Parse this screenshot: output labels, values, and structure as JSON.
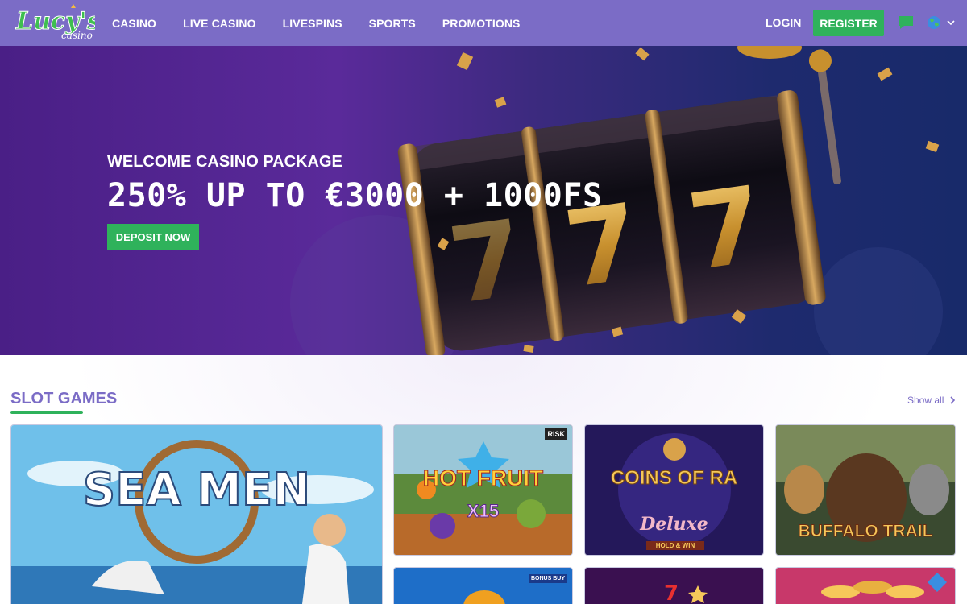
{
  "header": {
    "logo": "Lucy's casino",
    "nav": [
      "CASINO",
      "LIVE CASINO",
      "LIVESPINS",
      "SPORTS",
      "PROMOTIONS"
    ],
    "login": "LOGIN",
    "register": "REGISTER",
    "icons": [
      "chat-icon",
      "globe-icon",
      "chevron-down-icon"
    ]
  },
  "hero": {
    "subtitle": "WELCOME CASINO PACKAGE",
    "title": "250% UP TO €3000 + 1000FS",
    "cta": "DEPOSIT NOW",
    "slot_digits": "777"
  },
  "slots": {
    "title": "SLOT GAMES",
    "show_all": "Show all",
    "games": [
      {
        "name": "SEA MEN"
      },
      {
        "name": "HOT FRUIT",
        "sub": "X15",
        "badge": "RISK"
      },
      {
        "name": "COINS OF RA",
        "sub": "Deluxe",
        "tag": "HOLD & WIN"
      },
      {
        "name": "BUFFALO TRAIL"
      },
      {
        "name": "",
        "badge": "BONUS BUY"
      },
      {
        "name": ""
      },
      {
        "name": ""
      }
    ]
  },
  "colors": {
    "header": "#7b6cc6",
    "accent_green": "#2fb25b",
    "hero_purple": "#4a1f86"
  }
}
